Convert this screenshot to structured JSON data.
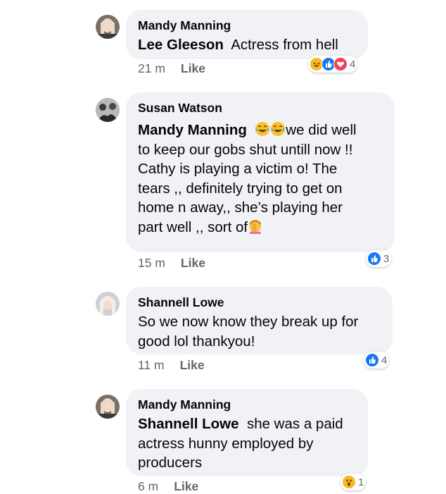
{
  "comments": [
    {
      "author": "Mandy Manning",
      "tag": "Lee Gleeson",
      "text": "Actress from hell",
      "time": "21 m",
      "like_label": "Like",
      "reaction_count": "4",
      "reactions": [
        "haha",
        "like",
        "love"
      ]
    },
    {
      "author": "Susan Watson",
      "tag": "Mandy Manning",
      "text_line1": "we did well",
      "text_rest": "to keep our gobs shut untill now !!\nCathy is playing a victim o! The\ntears ,, definitely trying to get on\nhome n away,, she’s playing her\npart well ,, sort of",
      "emojis": [
        "joy-emoji",
        "joy-emoji",
        "facepalm-emoji"
      ],
      "time": "15 m",
      "like_label": "Like",
      "reaction_count": "3",
      "reactions": [
        "like"
      ]
    },
    {
      "author": "Shannell Lowe",
      "text": "So we now know they break up for\ngood lol thankyou!",
      "time": "11 m",
      "like_label": "Like",
      "reaction_count": "4",
      "reactions": [
        "like"
      ]
    },
    {
      "author": "Mandy Manning",
      "tag": "Shannell Lowe",
      "text": "she was a paid\nactress hunny employed by\nproducers",
      "time": "6 m",
      "like_label": "Like",
      "reaction_count": "1",
      "reactions": [
        "wow"
      ]
    }
  ],
  "colors": {
    "bubble": "#f0f2f5",
    "meta_text": "#65676b",
    "like_blue": "#1877f2",
    "love_red": "#f33e58",
    "haha_yellow": "#f7b928"
  }
}
